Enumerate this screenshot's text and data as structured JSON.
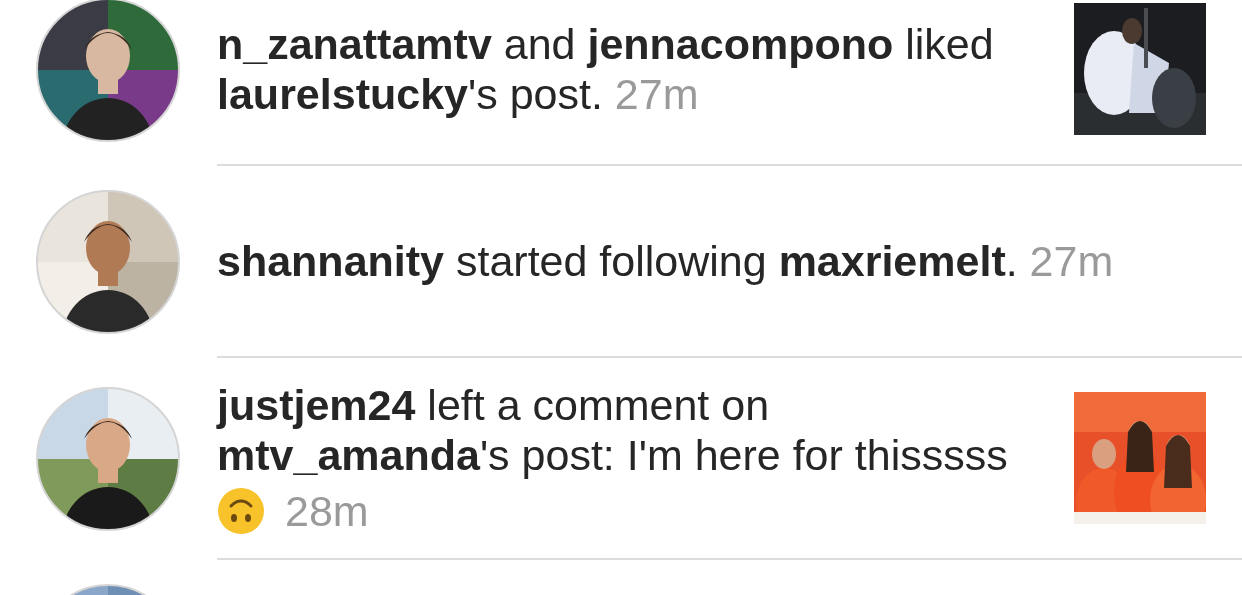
{
  "notifications": [
    {
      "avatar": {
        "kind": "picture"
      },
      "text": "**n_zanattamtv** and **jennacompono** liked **laurelstucky**'s post.",
      "time": "27m",
      "thumbnail": {
        "kind": "picture"
      }
    },
    {
      "avatar": {
        "kind": "picture"
      },
      "text": "**shannanity** started following **maxriemelt**.",
      "time": "27m"
    },
    {
      "avatar": {
        "kind": "picture"
      },
      "text": "**justjem24** left a comment on **mtv_amanda**'s post: I'm here for thisssss",
      "icon": {
        "kind": "upside-down-face"
      },
      "time": "28m",
      "thumbnail": {
        "kind": "picture"
      }
    },
    {
      "avatar": {
        "kind": "picture"
      }
    }
  ]
}
